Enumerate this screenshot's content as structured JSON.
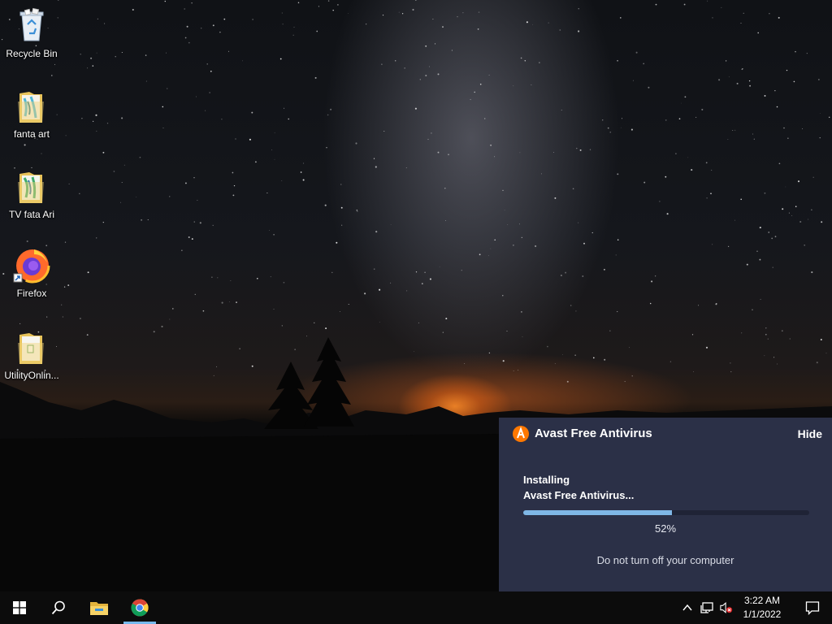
{
  "desktop": {
    "icons": [
      {
        "label": "Recycle Bin",
        "icon": "recycle-bin-icon"
      },
      {
        "label": "fanta art",
        "icon": "folder-icon"
      },
      {
        "label": "TV  fata Ari",
        "icon": "folder-icon"
      },
      {
        "label": "Firefox",
        "icon": "firefox-icon"
      },
      {
        "label": "UtilityOnlin...",
        "icon": "folder-icon"
      }
    ]
  },
  "avast": {
    "title": "Avast Free Antivirus",
    "hide_label": "Hide",
    "status_line1": "Installing",
    "status_line2": "Avast Free Antivirus...",
    "progress": 52,
    "progress_text": "52%",
    "warning": "Do not turn off your computer",
    "accent_color": "#ff7800",
    "progress_color": "#7fb7e6"
  },
  "taskbar": {
    "start": "windows-start-icon",
    "search": "search-icon",
    "pinned": [
      "file-explorer-icon",
      "chrome-icon"
    ],
    "tray": [
      "chevron-up-icon",
      "network-icon",
      "volume-muted-icon"
    ],
    "clock": {
      "time": "3:22 AM",
      "date": "1/1/2022"
    },
    "notifications": "action-center-icon"
  }
}
